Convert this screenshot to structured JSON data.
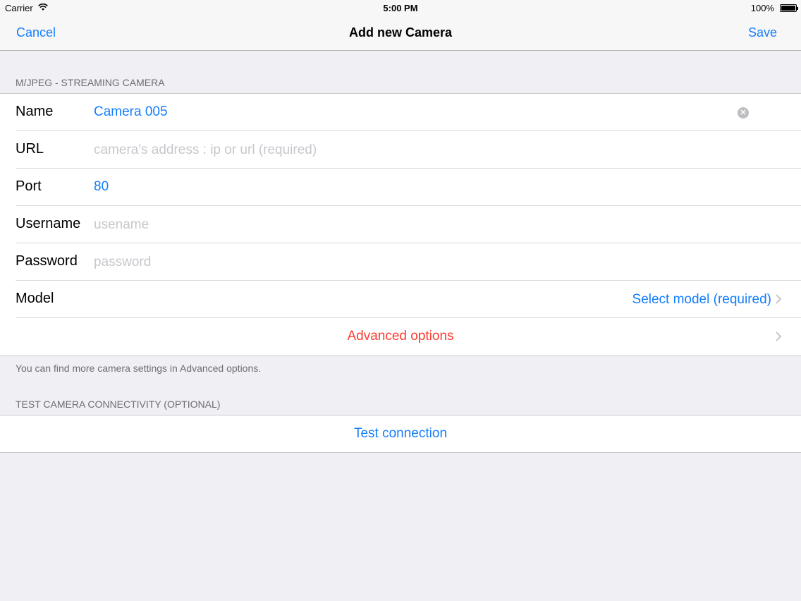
{
  "status_bar": {
    "carrier": "Carrier",
    "time": "5:00 PM",
    "battery": "100%"
  },
  "nav": {
    "cancel": "Cancel",
    "title": "Add new Camera",
    "save": "Save"
  },
  "section1": {
    "header": "M/JPEG - STREAMING CAMERA",
    "rows": {
      "name": {
        "label": "Name",
        "value": "Camera 005"
      },
      "url": {
        "label": "URL",
        "placeholder": "camera's address : ip or url (required)"
      },
      "port": {
        "label": "Port",
        "value": "80"
      },
      "username": {
        "label": "Username",
        "placeholder": "usename"
      },
      "password": {
        "label": "Password",
        "placeholder": "password"
      },
      "model": {
        "label": "Model",
        "value": "Select model (required)"
      },
      "advanced": {
        "label": "Advanced options"
      }
    },
    "footer": "You can find more camera settings in Advanced options."
  },
  "section2": {
    "header": "TEST CAMERA CONNECTIVITY (OPTIONAL)",
    "button": "Test connection"
  },
  "colors": {
    "accent": "#147efb",
    "destructive": "#ff3b30",
    "background": "#efeff4"
  },
  "icons": [
    "wifi-icon",
    "battery-icon",
    "clear-icon",
    "chevron-right-icon"
  ]
}
